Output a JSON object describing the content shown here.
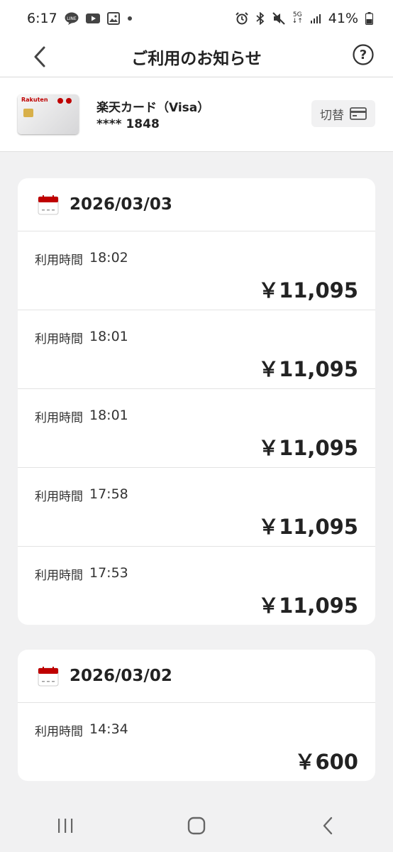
{
  "status_bar": {
    "time": "6:17",
    "network": "5G",
    "battery": "41%",
    "notification_icons": [
      "line-icon",
      "youtube-icon",
      "gallery-icon",
      "dot-icon"
    ],
    "system_icons": [
      "alarm-icon",
      "bluetooth-icon",
      "mute-icon",
      "signal-icon",
      "battery-icon"
    ]
  },
  "header": {
    "title": "ご利用のお知らせ"
  },
  "card": {
    "name": "楽天カード（Visa）",
    "number": "**** 1848",
    "switch_label": "切替",
    "logo_text": "Rakuten"
  },
  "sections": [
    {
      "date": "2026/03/03",
      "rows": [
        {
          "label": "利用時間",
          "time": "18:02",
          "amount": "￥11,095"
        },
        {
          "label": "利用時間",
          "time": "18:01",
          "amount": "￥11,095"
        },
        {
          "label": "利用時間",
          "time": "18:01",
          "amount": "￥11,095"
        },
        {
          "label": "利用時間",
          "time": "17:58",
          "amount": "￥11,095"
        },
        {
          "label": "利用時間",
          "time": "17:53",
          "amount": "￥11,095"
        }
      ]
    },
    {
      "date": "2026/03/02",
      "rows": [
        {
          "label": "利用時間",
          "time": "14:34",
          "amount": "￥600"
        }
      ]
    }
  ],
  "colors": {
    "accent": "#bf0000",
    "background": "#f1f1f2",
    "text": "#222222"
  }
}
